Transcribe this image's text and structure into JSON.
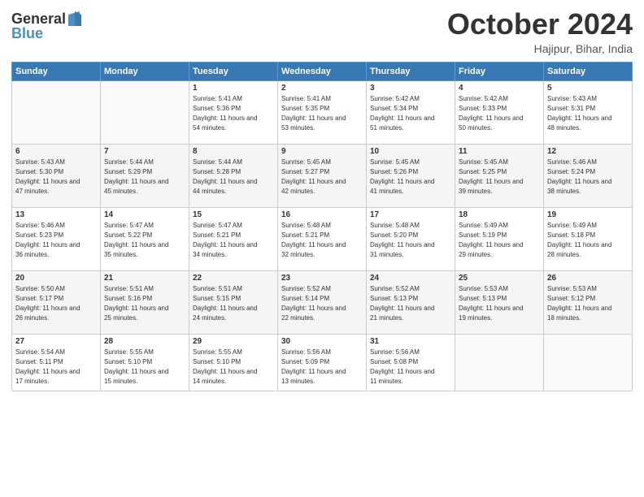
{
  "header": {
    "logo_line1": "General",
    "logo_line2": "Blue",
    "month_title": "October 2024",
    "location": "Hajipur, Bihar, India"
  },
  "days_of_week": [
    "Sunday",
    "Monday",
    "Tuesday",
    "Wednesday",
    "Thursday",
    "Friday",
    "Saturday"
  ],
  "weeks": [
    [
      {
        "day": "",
        "sunrise": "",
        "sunset": "",
        "daylight": ""
      },
      {
        "day": "",
        "sunrise": "",
        "sunset": "",
        "daylight": ""
      },
      {
        "day": "1",
        "sunrise": "Sunrise: 5:41 AM",
        "sunset": "Sunset: 5:36 PM",
        "daylight": "Daylight: 11 hours and 54 minutes."
      },
      {
        "day": "2",
        "sunrise": "Sunrise: 5:41 AM",
        "sunset": "Sunset: 5:35 PM",
        "daylight": "Daylight: 11 hours and 53 minutes."
      },
      {
        "day": "3",
        "sunrise": "Sunrise: 5:42 AM",
        "sunset": "Sunset: 5:34 PM",
        "daylight": "Daylight: 11 hours and 51 minutes."
      },
      {
        "day": "4",
        "sunrise": "Sunrise: 5:42 AM",
        "sunset": "Sunset: 5:33 PM",
        "daylight": "Daylight: 11 hours and 50 minutes."
      },
      {
        "day": "5",
        "sunrise": "Sunrise: 5:43 AM",
        "sunset": "Sunset: 5:31 PM",
        "daylight": "Daylight: 11 hours and 48 minutes."
      }
    ],
    [
      {
        "day": "6",
        "sunrise": "Sunrise: 5:43 AM",
        "sunset": "Sunset: 5:30 PM",
        "daylight": "Daylight: 11 hours and 47 minutes."
      },
      {
        "day": "7",
        "sunrise": "Sunrise: 5:44 AM",
        "sunset": "Sunset: 5:29 PM",
        "daylight": "Daylight: 11 hours and 45 minutes."
      },
      {
        "day": "8",
        "sunrise": "Sunrise: 5:44 AM",
        "sunset": "Sunset: 5:28 PM",
        "daylight": "Daylight: 11 hours and 44 minutes."
      },
      {
        "day": "9",
        "sunrise": "Sunrise: 5:45 AM",
        "sunset": "Sunset: 5:27 PM",
        "daylight": "Daylight: 11 hours and 42 minutes."
      },
      {
        "day": "10",
        "sunrise": "Sunrise: 5:45 AM",
        "sunset": "Sunset: 5:26 PM",
        "daylight": "Daylight: 11 hours and 41 minutes."
      },
      {
        "day": "11",
        "sunrise": "Sunrise: 5:45 AM",
        "sunset": "Sunset: 5:25 PM",
        "daylight": "Daylight: 11 hours and 39 minutes."
      },
      {
        "day": "12",
        "sunrise": "Sunrise: 5:46 AM",
        "sunset": "Sunset: 5:24 PM",
        "daylight": "Daylight: 11 hours and 38 minutes."
      }
    ],
    [
      {
        "day": "13",
        "sunrise": "Sunrise: 5:46 AM",
        "sunset": "Sunset: 5:23 PM",
        "daylight": "Daylight: 11 hours and 36 minutes."
      },
      {
        "day": "14",
        "sunrise": "Sunrise: 5:47 AM",
        "sunset": "Sunset: 5:22 PM",
        "daylight": "Daylight: 11 hours and 35 minutes."
      },
      {
        "day": "15",
        "sunrise": "Sunrise: 5:47 AM",
        "sunset": "Sunset: 5:21 PM",
        "daylight": "Daylight: 11 hours and 34 minutes."
      },
      {
        "day": "16",
        "sunrise": "Sunrise: 5:48 AM",
        "sunset": "Sunset: 5:21 PM",
        "daylight": "Daylight: 11 hours and 32 minutes."
      },
      {
        "day": "17",
        "sunrise": "Sunrise: 5:48 AM",
        "sunset": "Sunset: 5:20 PM",
        "daylight": "Daylight: 11 hours and 31 minutes."
      },
      {
        "day": "18",
        "sunrise": "Sunrise: 5:49 AM",
        "sunset": "Sunset: 5:19 PM",
        "daylight": "Daylight: 11 hours and 29 minutes."
      },
      {
        "day": "19",
        "sunrise": "Sunrise: 5:49 AM",
        "sunset": "Sunset: 5:18 PM",
        "daylight": "Daylight: 11 hours and 28 minutes."
      }
    ],
    [
      {
        "day": "20",
        "sunrise": "Sunrise: 5:50 AM",
        "sunset": "Sunset: 5:17 PM",
        "daylight": "Daylight: 11 hours and 26 minutes."
      },
      {
        "day": "21",
        "sunrise": "Sunrise: 5:51 AM",
        "sunset": "Sunset: 5:16 PM",
        "daylight": "Daylight: 11 hours and 25 minutes."
      },
      {
        "day": "22",
        "sunrise": "Sunrise: 5:51 AM",
        "sunset": "Sunset: 5:15 PM",
        "daylight": "Daylight: 11 hours and 24 minutes."
      },
      {
        "day": "23",
        "sunrise": "Sunrise: 5:52 AM",
        "sunset": "Sunset: 5:14 PM",
        "daylight": "Daylight: 11 hours and 22 minutes."
      },
      {
        "day": "24",
        "sunrise": "Sunrise: 5:52 AM",
        "sunset": "Sunset: 5:13 PM",
        "daylight": "Daylight: 11 hours and 21 minutes."
      },
      {
        "day": "25",
        "sunrise": "Sunrise: 5:53 AM",
        "sunset": "Sunset: 5:13 PM",
        "daylight": "Daylight: 11 hours and 19 minutes."
      },
      {
        "day": "26",
        "sunrise": "Sunrise: 5:53 AM",
        "sunset": "Sunset: 5:12 PM",
        "daylight": "Daylight: 11 hours and 18 minutes."
      }
    ],
    [
      {
        "day": "27",
        "sunrise": "Sunrise: 5:54 AM",
        "sunset": "Sunset: 5:11 PM",
        "daylight": "Daylight: 11 hours and 17 minutes."
      },
      {
        "day": "28",
        "sunrise": "Sunrise: 5:55 AM",
        "sunset": "Sunset: 5:10 PM",
        "daylight": "Daylight: 11 hours and 15 minutes."
      },
      {
        "day": "29",
        "sunrise": "Sunrise: 5:55 AM",
        "sunset": "Sunset: 5:10 PM",
        "daylight": "Daylight: 11 hours and 14 minutes."
      },
      {
        "day": "30",
        "sunrise": "Sunrise: 5:56 AM",
        "sunset": "Sunset: 5:09 PM",
        "daylight": "Daylight: 11 hours and 13 minutes."
      },
      {
        "day": "31",
        "sunrise": "Sunrise: 5:56 AM",
        "sunset": "Sunset: 5:08 PM",
        "daylight": "Daylight: 11 hours and 11 minutes."
      },
      {
        "day": "",
        "sunrise": "",
        "sunset": "",
        "daylight": ""
      },
      {
        "day": "",
        "sunrise": "",
        "sunset": "",
        "daylight": ""
      }
    ]
  ]
}
